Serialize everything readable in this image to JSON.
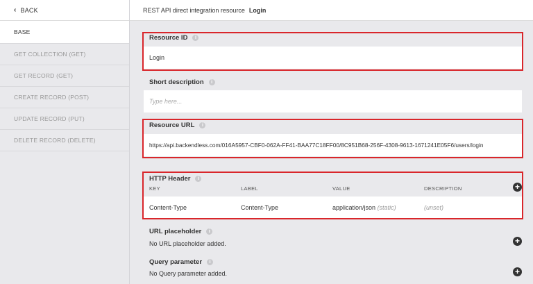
{
  "sidebar": {
    "back_label": "BACK",
    "items": [
      {
        "label": "BASE"
      },
      {
        "label": "GET COLLECTION (GET)"
      },
      {
        "label": "GET RECORD (GET)"
      },
      {
        "label": "CREATE RECORD (POST)"
      },
      {
        "label": "UPDATE RECORD (PUT)"
      },
      {
        "label": "DELETE RECORD (DELETE)"
      }
    ]
  },
  "header": {
    "prefix": "REST API direct integration resource",
    "title": "Login"
  },
  "form": {
    "resource_id": {
      "label": "Resource ID",
      "value": "Login"
    },
    "short_description": {
      "label": "Short description",
      "placeholder": "Type here..."
    },
    "resource_url": {
      "label": "Resource URL",
      "value": "https://api.backendless.com/016A5957-CBF0-062A-FF41-BAA77C18FF00/8C951B68-256F-4308-9613-1671241E05F6/users/login"
    },
    "http_header": {
      "label": "HTTP Header",
      "columns": [
        "KEY",
        "LABEL",
        "VALUE",
        "DESCRIPTION"
      ],
      "rows": [
        {
          "key": "Content-Type",
          "label": "Content-Type",
          "value": "application/json",
          "value_suffix": "(static)",
          "description": "(unset)"
        }
      ]
    },
    "url_placeholder": {
      "label": "URL placeholder",
      "empty_text": "No URL placeholder added."
    },
    "query_parameter": {
      "label": "Query parameter",
      "empty_text": "No Query parameter added."
    }
  },
  "colors": {
    "highlight": "#d9262b",
    "accent": "#333333"
  }
}
